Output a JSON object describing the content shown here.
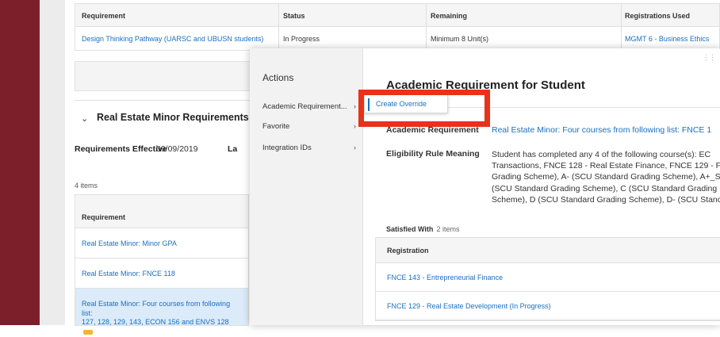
{
  "top_table": {
    "headers": [
      "Requirement",
      "Status",
      "Remaining",
      "Registrations Used"
    ],
    "row": {
      "requirement": "Design Thinking Pathway (UARSC and UBUSN students)",
      "status": "In Progress",
      "remaining": "Minimum 8 Unit(s)",
      "registrations_used": "MGMT 6 - Business Ethics"
    }
  },
  "minor_section": {
    "title": "Real Estate Minor Requirements",
    "requirements_effective_label": "Requirements Effective",
    "requirements_effective_date": "09/09/2019",
    "truncated_label": "La",
    "items_count": "4 items",
    "table_header": "Requirement",
    "rows": [
      "Real Estate Minor: Minor GPA",
      "Real Estate Minor: FNCE 118"
    ],
    "selected_row_line1": "Real Estate Minor: Four courses from following list:",
    "selected_row_line2": "127, 128, 129, 143, ECON 156 and ENVS 128"
  },
  "actions_menu": {
    "title": "Actions",
    "items": [
      {
        "label": "Academic Requirement..."
      },
      {
        "label": "Favorite"
      },
      {
        "label": "Integration IDs"
      }
    ],
    "arrow": "›",
    "submenu_item": "Create Override"
  },
  "detail": {
    "title": "Academic Requirement for Student",
    "academic_requirement_label": "Academic Requirement",
    "academic_requirement_value": "Real Estate Minor: Four courses from following list: FNCE 1",
    "eligibility_label": "Eligibility Rule Meaning",
    "eligibility_lines": [
      "Student has completed any 4 of the following course(s): EC",
      "Transactions, FNCE 128 - Real Estate Finance, FNCE 129 - F",
      "Grading Scheme), A- (SCU Standard Grading Scheme), A+_S",
      "(SCU Standard Grading Scheme), C (SCU Standard Grading",
      "Scheme), D (SCU Standard Grading Scheme), D- (SCU Stanc"
    ],
    "satisfied_label": "Satisfied With",
    "satisfied_count": "2 items",
    "registration_header": "Registration",
    "registrations": [
      "FNCE 143 - Entrepreneurial Finance",
      "FNCE 129 - Real Estate Development (In Progress)"
    ]
  },
  "colors": {
    "sidebar": "#7d1f2b",
    "link": "#1a6fc0",
    "highlight_box": "#e8321a",
    "selected_row": "#dcebfa"
  }
}
